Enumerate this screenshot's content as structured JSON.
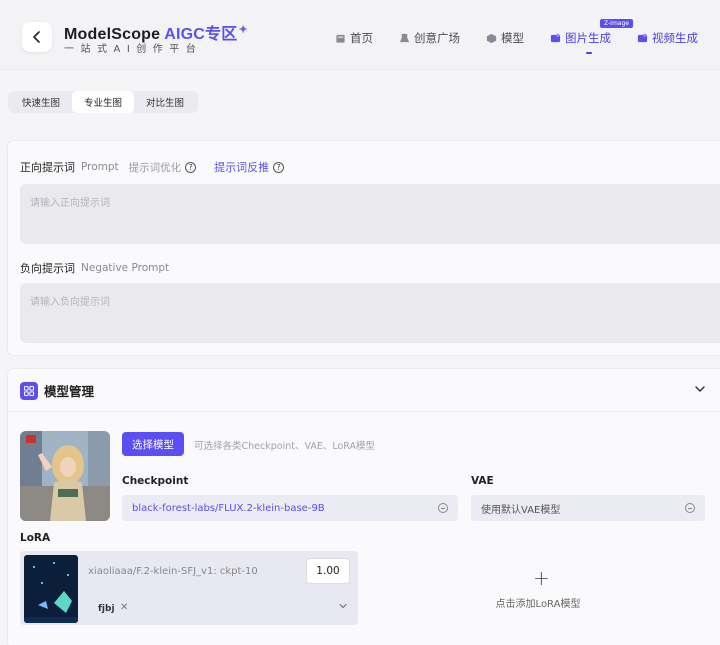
{
  "header": {
    "brand": "ModelScope",
    "aigc": "AIGC专区",
    "subtitle": "一站式AI创作平台",
    "nav": [
      {
        "label": "首页",
        "icon": "home-icon"
      },
      {
        "label": "创意广场",
        "icon": "creative-icon"
      },
      {
        "label": "模型",
        "icon": "model-icon"
      },
      {
        "label": "图片生成",
        "icon": "image-gen-icon"
      },
      {
        "label": "视频生成",
        "icon": "video-gen-icon"
      }
    ],
    "badge": "Z-Image"
  },
  "mode_tabs": [
    "快速生图",
    "专业生图",
    "对比生图"
  ],
  "prompt": {
    "positive_label": "正向提示词",
    "positive_en": "Prompt",
    "optimize": "提示词优化",
    "reverse": "提示词反推",
    "positive_placeholder": "请输入正向提示词",
    "negative_label": "负向提示词",
    "negative_en": "Negative Prompt",
    "negative_placeholder": "请输入负向提示词"
  },
  "model_panel": {
    "title": "模型管理",
    "select_button": "选择模型",
    "hint": "可选择各类Checkpoint、VAE、LoRA模型",
    "checkpoint_label": "Checkpoint",
    "checkpoint_value": "black-forest-labs/FLUX.2-klein-base-9B",
    "vae_label": "VAE",
    "vae_value": "使用默认VAE模型",
    "lora_label": "LoRA",
    "lora": {
      "name": "xiaoliaaa/F.2-klein-SFJ_v1: ckpt-10",
      "weight": "1.00",
      "tag": "fjbj"
    },
    "add_lora": "点击添加LoRA模型"
  },
  "colors": {
    "accent": "#5b4ff2",
    "input_bg": "#eaeaee"
  }
}
